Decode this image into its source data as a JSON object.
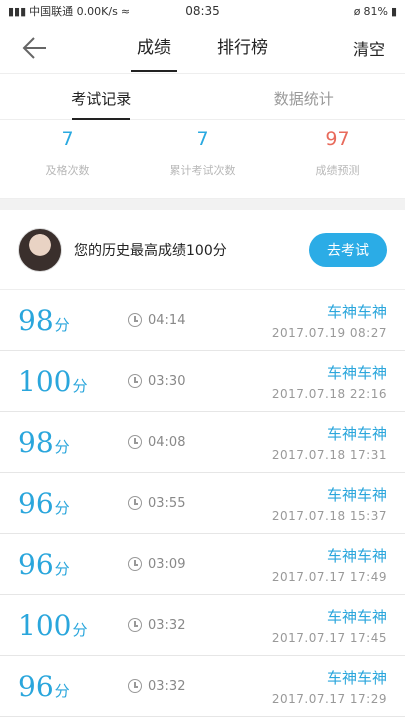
{
  "status_bar": {
    "left": "中国联通 0.00K/s",
    "time": "08:35",
    "battery": "81%"
  },
  "nav": {
    "tabs": [
      "成绩",
      "排行榜"
    ],
    "clear_label": "清空"
  },
  "sub_tabs": [
    "考试记录",
    "数据统计"
  ],
  "stats": [
    {
      "value": "7",
      "label": "及格次数"
    },
    {
      "value": "7",
      "label": "累计考试次数"
    },
    {
      "value": "97",
      "label": "成绩预测"
    }
  ],
  "best": {
    "text": "您的历史最高成绩100分",
    "button": "去考试"
  },
  "records": [
    {
      "score": "98",
      "unit": "分",
      "time": "04:14",
      "title": "车神车神",
      "date": "2017.07.19  08:27"
    },
    {
      "score": "100",
      "unit": "分",
      "time": "03:30",
      "title": "车神车神",
      "date": "2017.07.18  22:16"
    },
    {
      "score": "98",
      "unit": "分",
      "time": "04:08",
      "title": "车神车神",
      "date": "2017.07.18  17:31"
    },
    {
      "score": "96",
      "unit": "分",
      "time": "03:55",
      "title": "车神车神",
      "date": "2017.07.18  15:37"
    },
    {
      "score": "96",
      "unit": "分",
      "time": "03:09",
      "title": "车神车神",
      "date": "2017.07.17  17:49"
    },
    {
      "score": "100",
      "unit": "分",
      "time": "03:32",
      "title": "车神车神",
      "date": "2017.07.17  17:45"
    },
    {
      "score": "96",
      "unit": "分",
      "time": "03:32",
      "title": "车神车神",
      "date": "2017.07.17  17:29"
    }
  ]
}
